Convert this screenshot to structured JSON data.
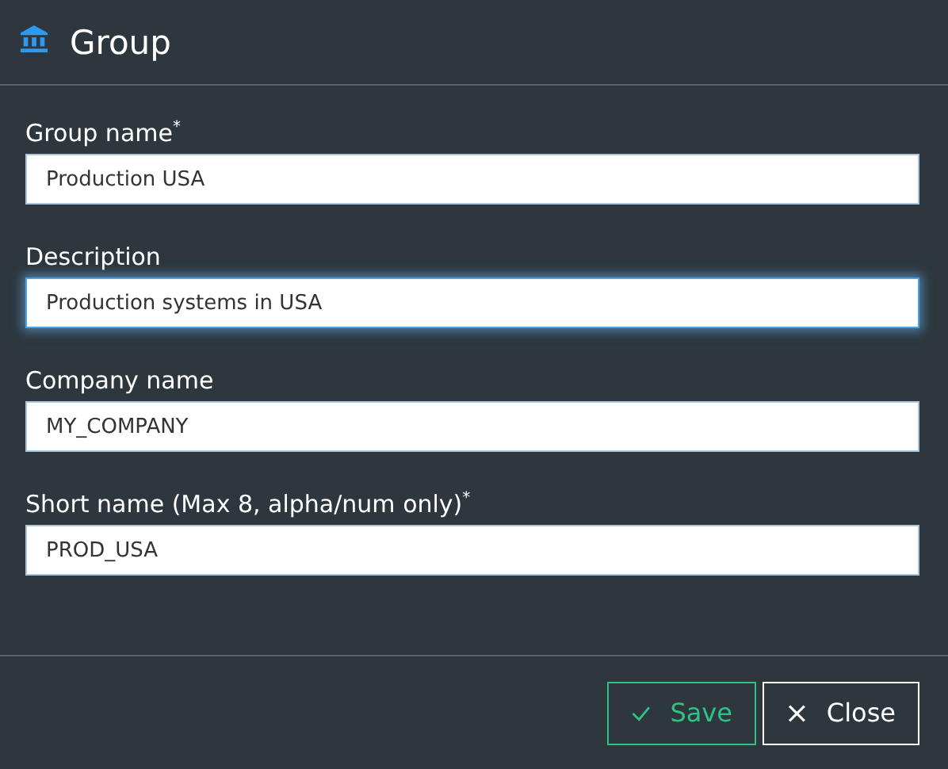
{
  "dialog": {
    "title": "Group"
  },
  "fields": [
    {
      "label": "Group name$^{*}$",
      "value": "Production USA",
      "focused": false
    },
    {
      "label": "Description",
      "value": "Production systems in USA",
      "focused": true
    },
    {
      "label": "Company name",
      "value": "MY_COMPANY",
      "focused": false
    },
    {
      "label": "Short name (Max 8, alpha/num only)$^{*}$",
      "value": "PROD_USA",
      "focused": false
    }
  ],
  "buttons": [
    {
      "kind": "save",
      "label": "Save"
    },
    {
      "kind": "close",
      "label": "Close"
    }
  ]
}
